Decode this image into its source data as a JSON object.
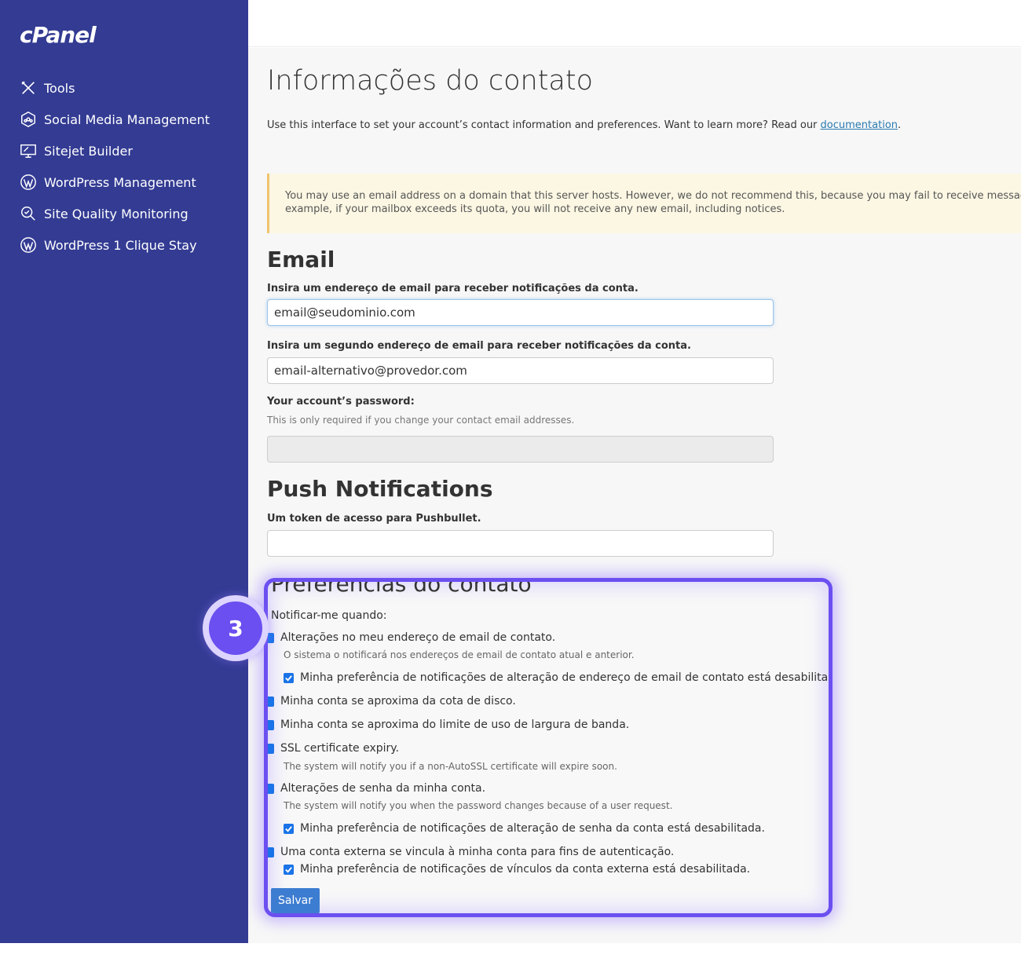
{
  "app": {
    "logo_text": "cPanel"
  },
  "sidebar": {
    "items": [
      {
        "label": "Tools",
        "icon": "tools-icon"
      },
      {
        "label": "Social Media Management",
        "icon": "social-media-icon"
      },
      {
        "label": "Sitejet Builder",
        "icon": "sitejet-icon"
      },
      {
        "label": "WordPress Management",
        "icon": "wordpress-icon"
      },
      {
        "label": "Site Quality Monitoring",
        "icon": "site-quality-icon"
      },
      {
        "label": "WordPress 1 Clique Stay",
        "icon": "wordpress-icon"
      }
    ]
  },
  "page": {
    "title": "Informações do contato",
    "intro_text": "Use this interface to set your account’s contact information and preferences. Want to learn more? Read our ",
    "intro_link": "documentation",
    "intro_end": ".",
    "warning_line1": "You may use an email address on a domain that this server hosts. However, we do not recommend this, because you may fail to receive messages. For",
    "warning_line2": "example, if your mailbox exceeds its quota, you will not receive any new email, including notices."
  },
  "email_section": {
    "title": "Email",
    "label1": "Insira um endereço de email para receber notificações da conta.",
    "value1": "email@seudominio.com",
    "label2": "Insira um segundo endereço de email para receber notificações da conta.",
    "value2": "email-alternativo@provedor.com",
    "password_label": "Your account’s password:",
    "password_help": "This is only required if you change your contact email addresses.",
    "password_value": ""
  },
  "push_section": {
    "title": "Push Notifications",
    "label": "Um token de acesso para Pushbullet.",
    "value": ""
  },
  "preferences": {
    "title": "Preferências do contato",
    "subtitle": "Notificar-me quando:",
    "items": {
      "email_change": "Alterações no meu endereço de email de contato.",
      "email_change_help": "O sistema o notificará nos endereços de email de contato atual e anterior.",
      "email_change_disabled": "Minha preferência de notificações de alteração de endereço de email de contato está desabilitada.",
      "disk_quota": "Minha conta se aproxima da cota de disco.",
      "bandwidth": "Minha conta se aproxima do limite de uso de largura de banda.",
      "ssl_expiry": "SSL certificate expiry.",
      "ssl_expiry_help": "The system will notify you if a non-AutoSSL certificate will expire soon.",
      "password_change": "Alterações de senha da minha conta.",
      "password_change_help": "The system will notify you when the password changes because of a user request.",
      "password_change_disabled": "Minha preferência de notificações de alteração de senha da conta está desabilitada.",
      "external_link": "Uma conta externa se vincula à minha conta para fins de autenticação.",
      "external_link_disabled": "Minha preferência de notificações de vínculos da conta externa está desabilitada."
    },
    "save_label": "Salvar"
  },
  "annotation": {
    "step_number": "3",
    "accent_color": "#6b4ff0"
  },
  "colors": {
    "sidebar": "#333b93",
    "link": "#2a7ab0",
    "checkbox": "#1a73e8",
    "button": "#3d7dd1"
  }
}
